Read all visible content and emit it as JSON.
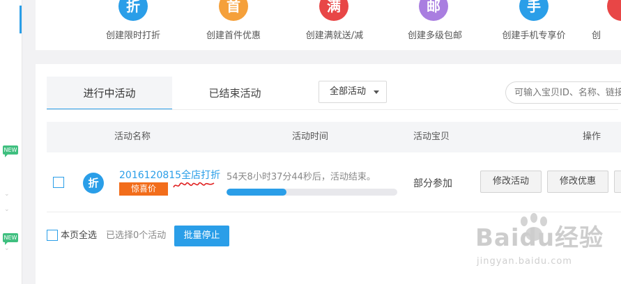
{
  "sidebar": {
    "badges": [
      "NEW",
      "NEW"
    ]
  },
  "quick_actions": [
    {
      "icon_char": "折",
      "label": "创建限时打折",
      "color": "#2a9ee8",
      "icon": "discount-icon"
    },
    {
      "icon_char": "首",
      "label": "创建首件优惠",
      "color": "#f5a03a",
      "icon": "first-item-icon"
    },
    {
      "icon_char": "满",
      "label": "创建满就送/减",
      "color": "#e84646",
      "icon": "full-reduction-icon"
    },
    {
      "icon_char": "邮",
      "label": "创建多级包邮",
      "color": "#a97ee0",
      "icon": "free-shipping-icon"
    },
    {
      "icon_char": "手",
      "label": "创建手机专享价",
      "color": "#2a9ee8",
      "icon": "mobile-price-icon"
    },
    {
      "icon_char": "",
      "label": "创",
      "color": "#e84646",
      "icon": "more-icon"
    }
  ],
  "tabs": {
    "active": "进行中活动",
    "ended": "已结束活动"
  },
  "filter": {
    "value": "全部活动"
  },
  "search": {
    "placeholder": "可输入宝贝ID、名称、链接"
  },
  "table": {
    "headers": {
      "name": "活动名称",
      "time": "活动时间",
      "items": "活动宝贝",
      "actions": "操作"
    },
    "rows": [
      {
        "icon_char": "折",
        "name": "2016120815全店打折",
        "tag": "惊喜价",
        "time_text": "54天8小时37分44秒后，活动结束。",
        "progress": 0.35,
        "scope": "部分参加",
        "buttons": [
          "修改活动",
          "修改优惠"
        ]
      }
    ]
  },
  "footer": {
    "select_all": "本页全选",
    "selected_count": "已选择0个活动",
    "batch_stop": "批量停止"
  },
  "watermark": {
    "text": "Baidu经验",
    "url": "jingyan.baidu.com"
  },
  "colors": {
    "accent": "#2a9ee8",
    "tag": "#f26d1b",
    "new_badge": "#3fbf7f"
  }
}
